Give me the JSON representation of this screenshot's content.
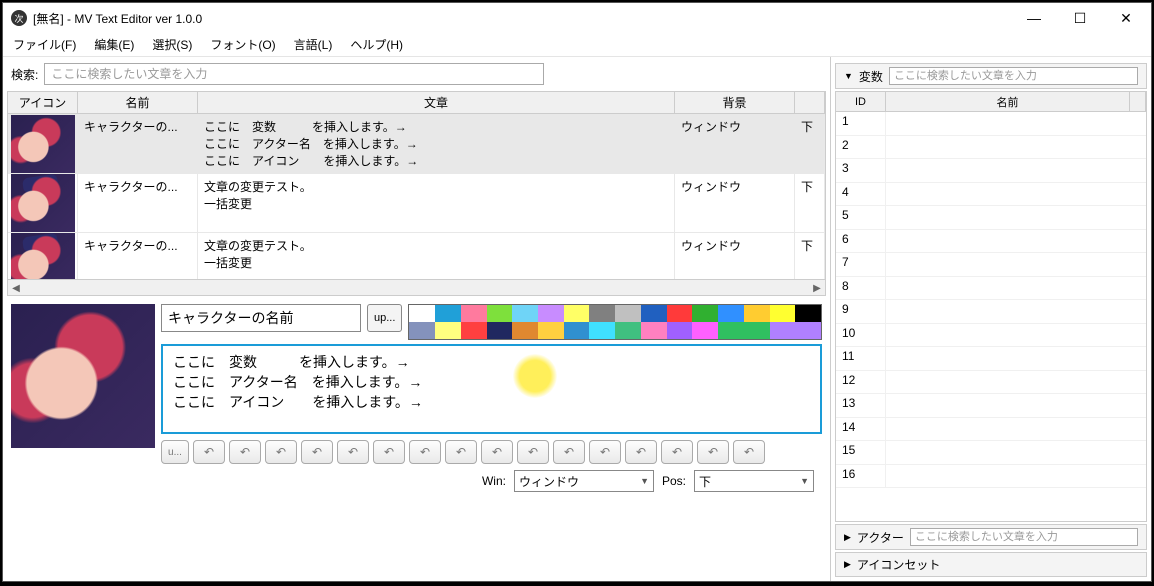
{
  "window": {
    "title": "[無名] - MV Text Editor ver 1.0.0"
  },
  "menu": {
    "file": "ファイル(F)",
    "edit": "編集(E)",
    "select": "選択(S)",
    "font": "フォント(O)",
    "lang": "言語(L)",
    "help": "ヘルプ(H)"
  },
  "search": {
    "label": "検索:",
    "placeholder": "ここに検索したい文章を入力"
  },
  "grid": {
    "headers": {
      "icon": "アイコン",
      "name": "名前",
      "text": "文章",
      "background": "背景"
    },
    "rows": [
      {
        "name": "キャラクターの...",
        "text": "ここに　変数　　　を挿入します。→\nここに　アクター名　を挿入します。→\nここに　アイコン　　を挿入します。→",
        "bg": "ウィンドウ",
        "pos": "下",
        "hat": false,
        "selected": true
      },
      {
        "name": "キャラクターの...",
        "text": "文章の変更テスト。\n一括変更",
        "bg": "ウィンドウ",
        "pos": "下",
        "hat": true,
        "selected": false
      },
      {
        "name": "キャラクターの...",
        "text": "文章の変更テスト。\n一括変更",
        "bg": "ウィンドウ",
        "pos": "下",
        "hat": true,
        "selected": false
      }
    ]
  },
  "editor": {
    "name_value": "キャラクターの名前",
    "up_button": "up...",
    "message": "ここに　変数　　　を挿入します。→\nここに　アクター名　を挿入します。→\nここに　アイコン　　を挿入します。→",
    "undo_btn": "u...",
    "win_label": "Win:",
    "pos_label": "Pos:",
    "win_value": "ウィンドウ",
    "pos_value": "下"
  },
  "palette": [
    "#ffffff",
    "#20a0d8",
    "#ff7a9e",
    "#7ee03c",
    "#6fd4f7",
    "#c88cff",
    "#ffff66",
    "#808080",
    "#c0c0c0",
    "#2060c0",
    "#ff3a3a",
    "#30b030",
    "#3090ff",
    "#ffcc30",
    "#ffff30",
    "#000000",
    "#8492bc",
    "#ffff80",
    "#ff4040",
    "#202860",
    "#e08830",
    "#ffd040",
    "#3090d0",
    "#40e0ff",
    "#40c080",
    "#ff80c0",
    "#a060ff",
    "#ff60ff",
    "#30c060",
    "#30c060",
    "#b080ff",
    "#b080ff"
  ],
  "side": {
    "variables": {
      "label": "変数",
      "search_placeholder": "ここに検索したい文章を入力",
      "headers": {
        "id": "ID",
        "name": "名前"
      },
      "rows": [
        1,
        2,
        3,
        4,
        5,
        6,
        7,
        8,
        9,
        10,
        11,
        12,
        13,
        14,
        15,
        16
      ]
    },
    "actors": {
      "label": "アクター",
      "search_placeholder": "ここに検索したい文章を入力"
    },
    "iconset": {
      "label": "アイコンセット"
    }
  }
}
